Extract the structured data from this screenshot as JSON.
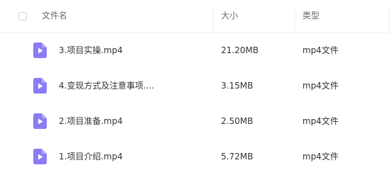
{
  "header": {
    "name_label": "文件名",
    "size_label": "大小",
    "type_label": "类型"
  },
  "files": [
    {
      "name": "3.项目实操.mp4",
      "size": "21.20MB",
      "type": "mp4文件",
      "icon": "video-file-icon"
    },
    {
      "name": "4.变现方式及注意事项....",
      "size": "3.15MB",
      "type": "mp4文件",
      "icon": "video-file-icon"
    },
    {
      "name": "2.项目准备.mp4",
      "size": "2.50MB",
      "type": "mp4文件",
      "icon": "video-file-icon"
    },
    {
      "name": "1.项目介绍.mp4",
      "size": "5.72MB",
      "type": "mp4文件",
      "icon": "video-file-icon"
    }
  ],
  "colors": {
    "icon_fill": "#8b7cf6",
    "icon_play": "#ffffff",
    "text": "#333333",
    "header_text": "#666a70"
  }
}
